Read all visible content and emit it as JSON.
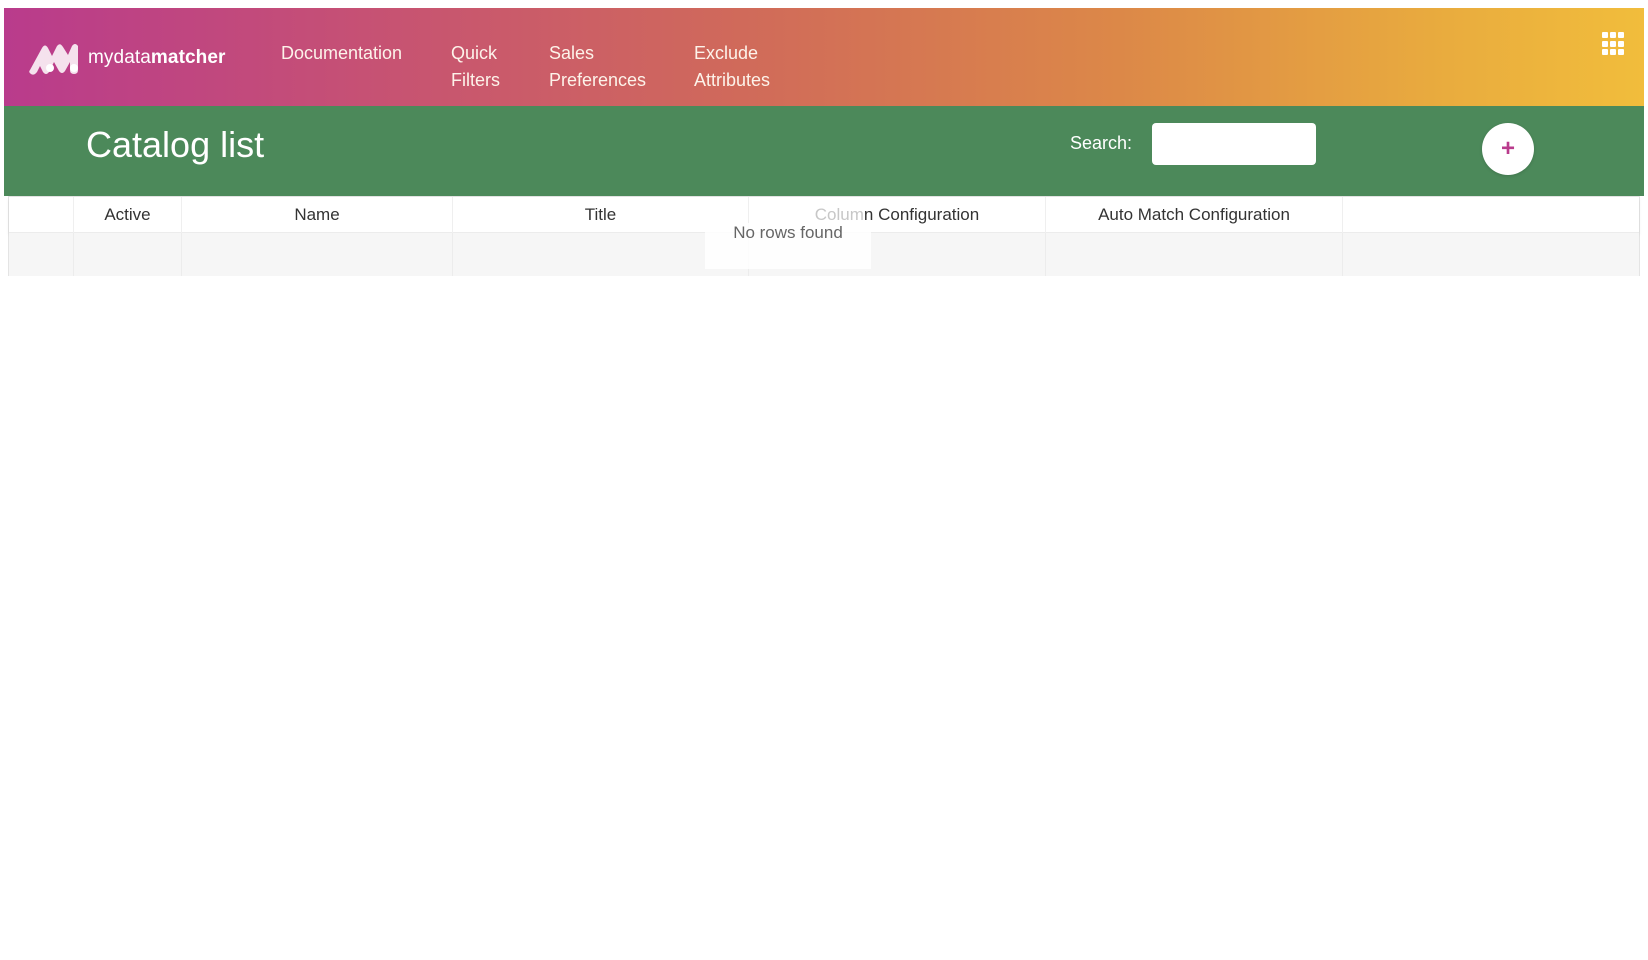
{
  "brand": {
    "name_light": "mydata",
    "name_bold": "matcher"
  },
  "nav": {
    "items": [
      {
        "line1": "Documentation",
        "line2": ""
      },
      {
        "line1": "Quick",
        "line2": "Filters"
      },
      {
        "line1": "Sales",
        "line2": "Preferences"
      },
      {
        "line1": "Exclude",
        "line2": "Attributes"
      }
    ]
  },
  "header": {
    "title": "Catalog list",
    "search_label": "Search:",
    "search_value": "",
    "add_label": "+"
  },
  "table": {
    "columns": [
      "",
      "Active",
      "Name",
      "Title",
      "Column Configuration",
      "Auto Match Configuration",
      ""
    ],
    "col_config_faded": "Colum",
    "col_config_rest": "n Configuration",
    "empty_message": "No rows found"
  },
  "colors": {
    "gradient_start": "#b93b8c",
    "gradient_end": "#f1bd3c",
    "header_green": "#4c895a",
    "accent": "#b93b8c"
  }
}
